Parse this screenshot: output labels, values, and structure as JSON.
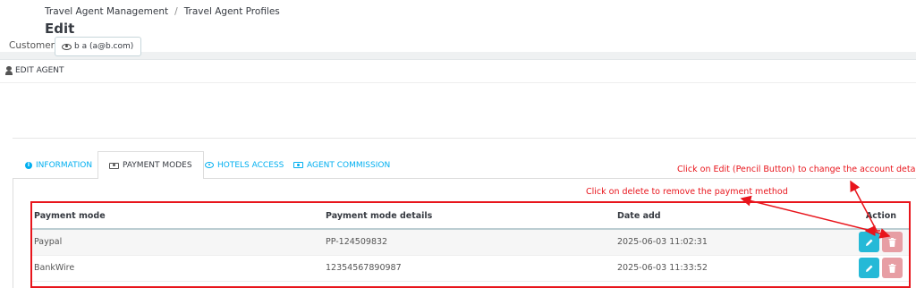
{
  "breadcrumb": {
    "items": [
      "Travel Agent Management",
      "Travel Agent Profiles"
    ],
    "separator": "/"
  },
  "page_title": "Edit",
  "panel": {
    "title": "EDIT AGENT",
    "icon": "user-icon"
  },
  "customer": {
    "label": "Customer",
    "value": "b a (a@b.com)",
    "icon": "eye-icon"
  },
  "tabs": [
    {
      "label": "INFORMATION",
      "icon": "info-circle-icon",
      "active": false
    },
    {
      "label": "PAYMENT MODES",
      "icon": "money-icon",
      "active": true
    },
    {
      "label": "HOTELS ACCESS",
      "icon": "eye-icon",
      "active": false
    },
    {
      "label": "AGENT COMMISSION",
      "icon": "money-icon",
      "active": false
    }
  ],
  "table": {
    "headers": [
      "Payment mode",
      "Payment mode details",
      "Date add",
      "Action"
    ],
    "rows": [
      {
        "mode": "Paypal",
        "details": "PP-124509832",
        "date": "2025-06-03 11:02:31"
      },
      {
        "mode": "BankWire",
        "details": "12354567890987",
        "date": "2025-06-03 11:33:52"
      }
    ]
  },
  "annotations": {
    "edit": "Click on Edit  (Pencil Button) to change the account details",
    "delete": "Click on delete to remove the payment method"
  },
  "colors": {
    "accent": "#25b9d7",
    "link": "#00aff0",
    "delete": "#e79ea4",
    "annotation": "#e8151c"
  }
}
